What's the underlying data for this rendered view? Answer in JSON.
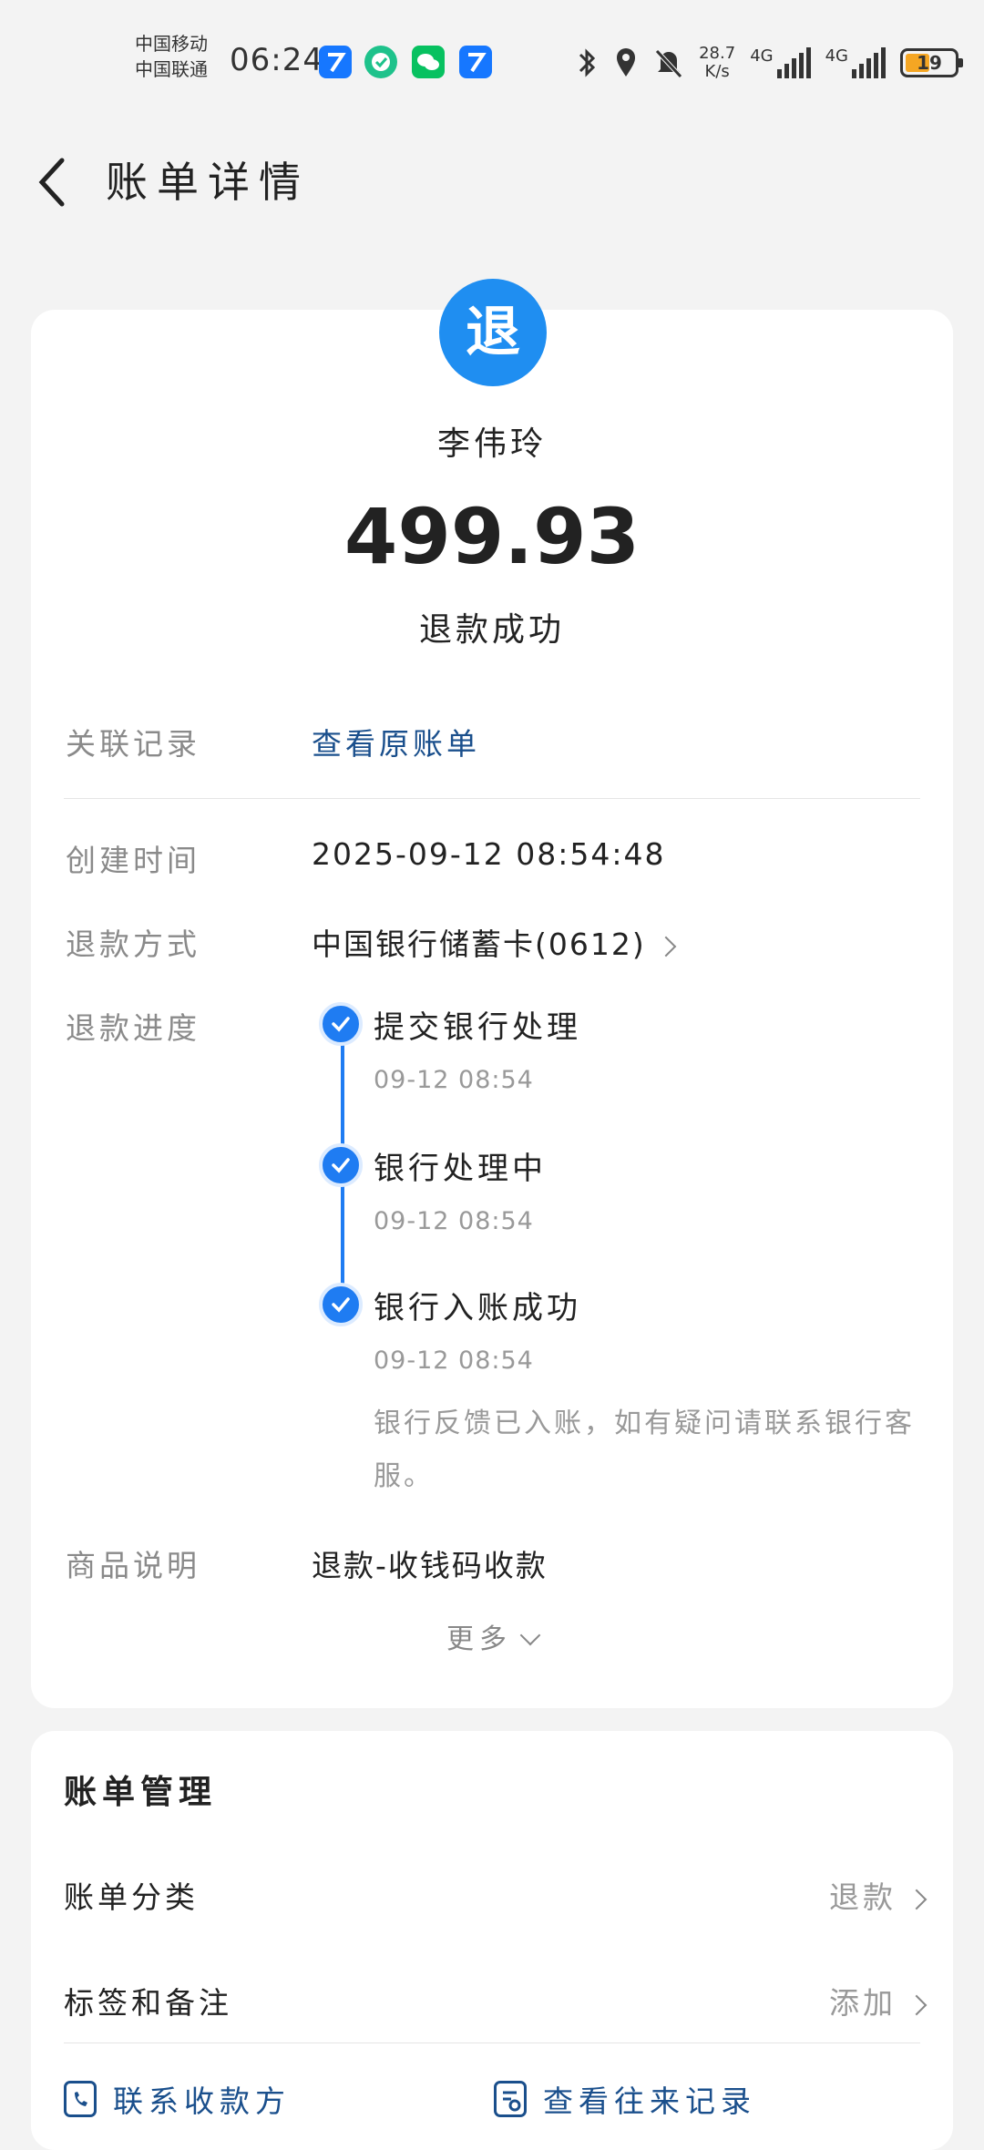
{
  "status_bar": {
    "carrier_1": "中国移动",
    "carrier_2": "中国联通",
    "time": "06:24",
    "net_speed_value": "28.7",
    "net_speed_unit": "K/s",
    "network_1": "4G",
    "network_2": "4G",
    "battery": "19",
    "icons": [
      "alipay-icon",
      "check-shield-icon",
      "wechat-icon",
      "alipay-icon",
      "bluetooth-icon",
      "location-icon",
      "mute-bell-icon",
      "signal-icon",
      "signal-icon",
      "battery-icon"
    ],
    "colors": {
      "app_blue": "#1677ff",
      "wechat_green": "#07c160",
      "check_green": "#1ec28b",
      "battery_fill": "#f5a623"
    }
  },
  "header": {
    "title": "账单详情",
    "back_icon": "chevron-left-icon"
  },
  "bill": {
    "badge_text": "退",
    "badge_color": "#1f8ef1",
    "payee": "李伟玲",
    "amount": "499.93",
    "status": "退款成功",
    "rows": {
      "related_label": "关联记录",
      "related_value": "查看原账单",
      "created_label": "创建时间",
      "created_value": "2025-09-12 08:54:48",
      "method_label": "退款方式",
      "method_value": "中国银行储蓄卡(0612)",
      "progress_label": "退款进度",
      "goods_label": "商品说明",
      "goods_value": "退款-收钱码收款"
    },
    "progress": [
      {
        "title": "提交银行处理",
        "time": "09-12 08:54"
      },
      {
        "title": "银行处理中",
        "time": "09-12 08:54"
      },
      {
        "title": "银行入账成功",
        "time": "09-12 08:54"
      }
    ],
    "progress_note": "银行反馈已入账，如有疑问请联系银行客服。",
    "more": "更多",
    "accent": "#1f7cf2",
    "link_color": "#1a4f8c"
  },
  "management": {
    "title": "账单管理",
    "category_label": "账单分类",
    "category_value": "退款",
    "tag_label": "标签和备注",
    "tag_value": "添加",
    "contact_label": "联系收款方",
    "history_label": "查看往来记录"
  }
}
